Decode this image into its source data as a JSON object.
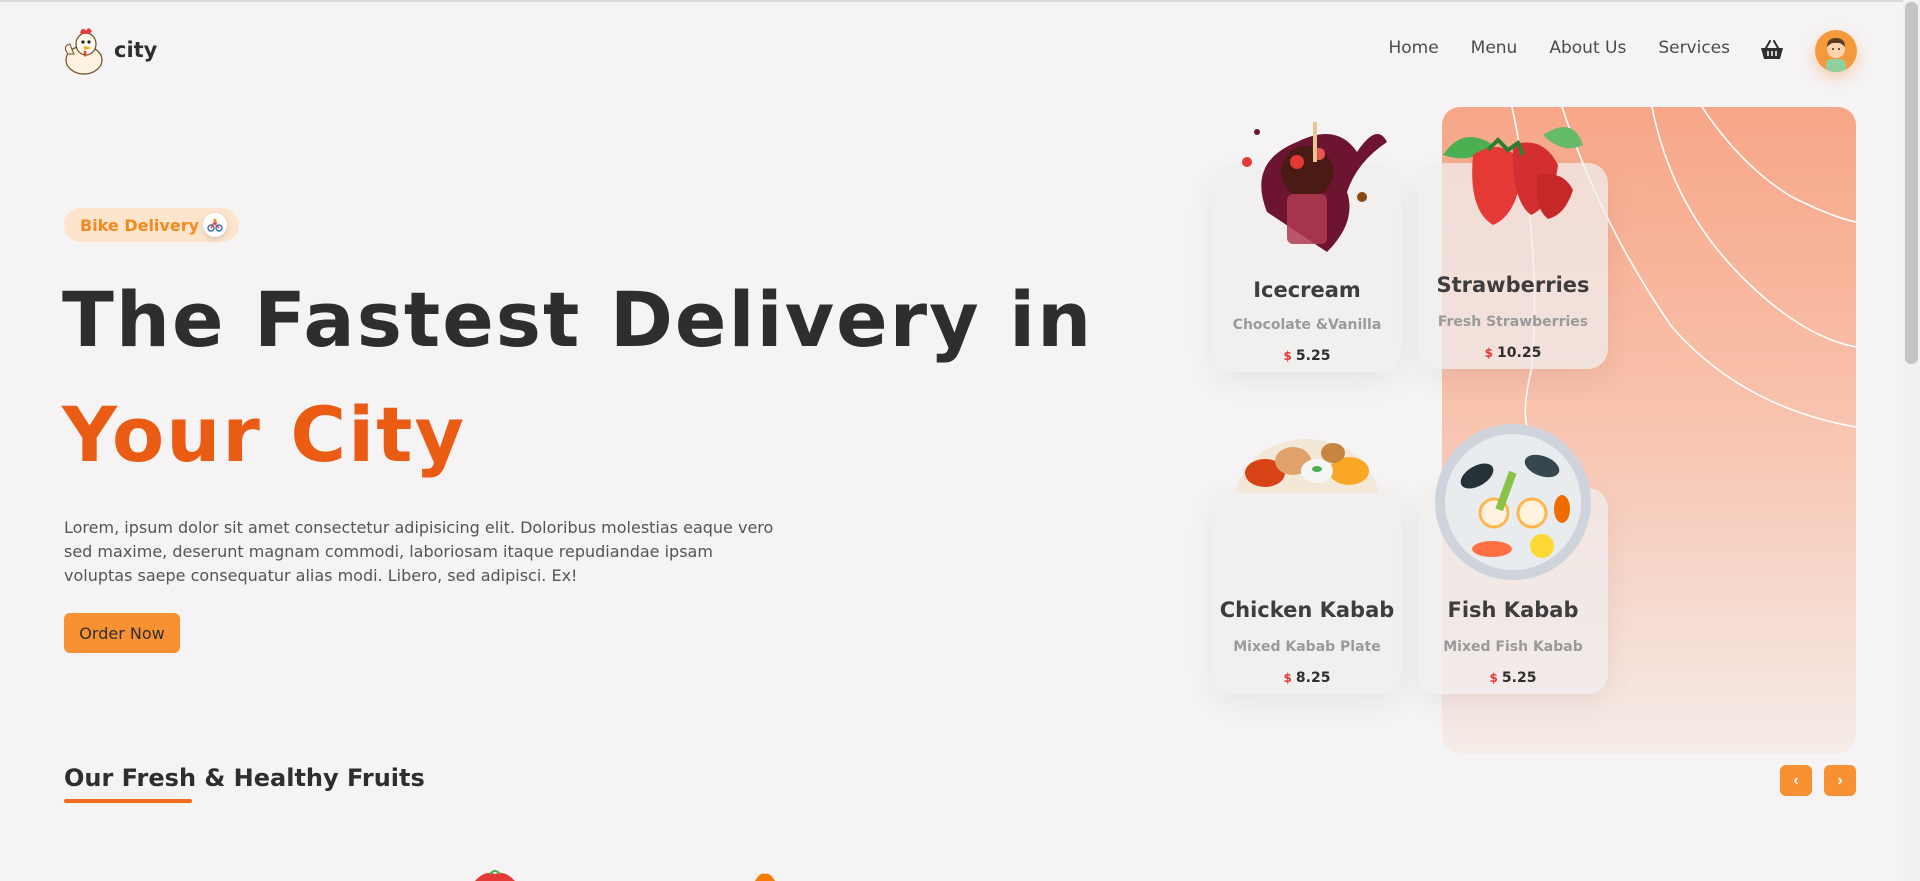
{
  "brand": {
    "name": "city"
  },
  "nav": {
    "items": [
      "Home",
      "Menu",
      "About Us",
      "Services"
    ]
  },
  "hero": {
    "badge": "Bike Delivery",
    "title_line1": "The Fastest Delivery in",
    "title_line2": "Your City",
    "description": "Lorem, ipsum dolor sit amet consectetur adipisicing elit. Doloribus molestias eaque vero sed maxime, deserunt magnam commodi, laboriosam itaque repudiandae ipsam voluptas saepe consequatur alias modi. Libero, sed adipisci. Ex!",
    "cta": "Order Now"
  },
  "cards": [
    {
      "name": "Icecream",
      "subtitle": "Chocolate &Vanilla",
      "currency": "$",
      "price": "5.25"
    },
    {
      "name": "Strawberries",
      "subtitle": "Fresh Strawberries",
      "currency": "$",
      "price": "10.25"
    },
    {
      "name": "Chicken Kabab",
      "subtitle": "Mixed Kabab Plate",
      "currency": "$",
      "price": "8.25"
    },
    {
      "name": "Fish Kabab",
      "subtitle": "Mixed Fish Kabab",
      "currency": "$",
      "price": "5.25"
    }
  ],
  "section": {
    "title": "Our Fresh & Healthy Fruits",
    "prev": "‹",
    "next": "›"
  },
  "colors": {
    "accent": "#f89132",
    "headline_accent": "#ea5c13",
    "price_currency": "#e53935"
  },
  "icons": [
    "chicken-logo-icon",
    "bike-icon",
    "basket-icon",
    "avatar-icon",
    "chevron-left-icon",
    "chevron-right-icon"
  ]
}
